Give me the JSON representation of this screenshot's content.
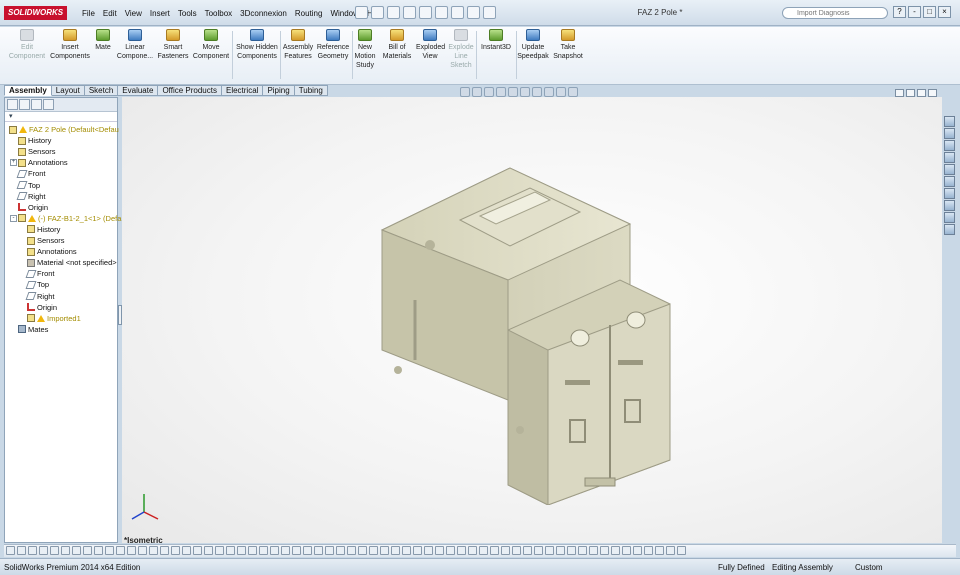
{
  "app": {
    "brand": "SOLIDWORKS",
    "document_title": "FAZ 2 Pole *"
  },
  "menu": [
    "File",
    "Edit",
    "View",
    "Insert",
    "Tools",
    "Toolbox",
    "3Dconnexion",
    "Routing",
    "Window",
    "Help"
  ],
  "search": {
    "placeholder": "Import Diagnosis"
  },
  "window_controls": [
    "?",
    "-",
    "□",
    "×"
  ],
  "ribbon": [
    {
      "label": "Edit Component",
      "disabled": true
    },
    {
      "label": "Insert Components"
    },
    {
      "label": "Mate"
    },
    {
      "label": "Linear Compone..."
    },
    {
      "label": "Smart Fasteners"
    },
    {
      "label": "Move Component"
    },
    {
      "label": "Show Hidden Components"
    },
    {
      "label": "Assembly Features"
    },
    {
      "label": "Reference Geometry"
    },
    {
      "label": "New Motion Study"
    },
    {
      "label": "Bill of Materials"
    },
    {
      "label": "Exploded View"
    },
    {
      "label": "Explode Line Sketch",
      "disabled": true
    },
    {
      "label": "Instant3D"
    },
    {
      "label": "Update Speedpak"
    },
    {
      "label": "Take Snapshot"
    }
  ],
  "command_tabs": [
    "Assembly",
    "Layout",
    "Sketch",
    "Evaluate",
    "Office Products",
    "Electrical",
    "Piping",
    "Tubing"
  ],
  "active_tab": "Assembly",
  "tree": [
    {
      "label": "FAZ 2 Pole  (Default<Defau",
      "level": 0,
      "icon": "assembly",
      "warn": true,
      "yellow": true
    },
    {
      "label": "History",
      "level": 1,
      "icon": "folder"
    },
    {
      "label": "Sensors",
      "level": 1,
      "icon": "folder"
    },
    {
      "label": "Annotations",
      "level": 1,
      "icon": "folder",
      "expand": "+"
    },
    {
      "label": "Front",
      "level": 1,
      "icon": "plane"
    },
    {
      "label": "Top",
      "level": 1,
      "icon": "plane"
    },
    {
      "label": "Right",
      "level": 1,
      "icon": "plane"
    },
    {
      "label": "Origin",
      "level": 1,
      "icon": "origin"
    },
    {
      "label": "(-) FAZ-B1-2_1<1> (Defa",
      "level": 1,
      "icon": "part",
      "warn": true,
      "yellow": true,
      "expand": "-"
    },
    {
      "label": "History",
      "level": 2,
      "icon": "folder"
    },
    {
      "label": "Sensors",
      "level": 2,
      "icon": "folder"
    },
    {
      "label": "Annotations",
      "level": 2,
      "icon": "folder"
    },
    {
      "label": "Material <not specified>",
      "level": 2,
      "icon": "material"
    },
    {
      "label": "Front",
      "level": 2,
      "icon": "plane"
    },
    {
      "label": "Top",
      "level": 2,
      "icon": "plane"
    },
    {
      "label": "Right",
      "level": 2,
      "icon": "plane"
    },
    {
      "label": "Origin",
      "level": 2,
      "icon": "origin"
    },
    {
      "label": "Imported1",
      "level": 2,
      "icon": "folder",
      "warn": true,
      "yellow": true
    },
    {
      "label": "Mates",
      "level": 1,
      "icon": "mates"
    }
  ],
  "viewport": {
    "view_name": "*Isometric",
    "model_color": "#d8d6bf"
  },
  "status": {
    "edition": "SolidWorks Premium 2014 x64 Edition",
    "state": "Fully Defined",
    "mode": "Editing Assembly",
    "units": "Custom"
  }
}
